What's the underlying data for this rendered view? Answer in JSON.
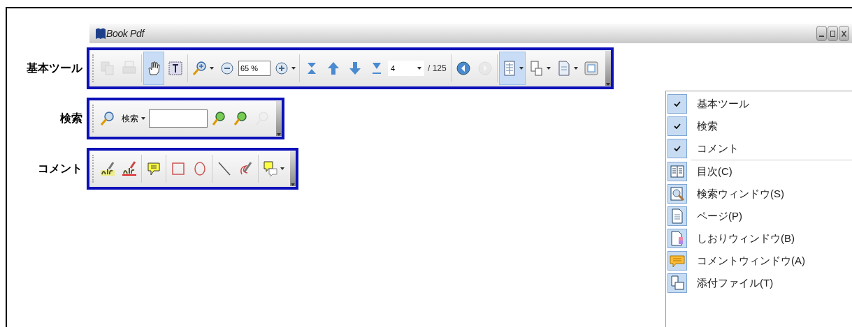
{
  "window": {
    "title": "Book Pdf"
  },
  "toolbars": [
    {
      "label": "基本ツール",
      "items": [
        {
          "kind": "button",
          "disabled": true,
          "selected": false
        },
        {
          "kind": "button",
          "disabled": true,
          "selected": false
        },
        {
          "kind": "sep"
        },
        {
          "kind": "button",
          "disabled": false,
          "selected": true
        },
        {
          "kind": "button",
          "disabled": false,
          "selected": false
        },
        {
          "kind": "sep"
        },
        {
          "kind": "menu-button",
          "disabled": false,
          "selected": false
        },
        {
          "kind": "button",
          "disabled": false,
          "selected": false
        },
        {
          "kind": "field",
          "value": "65 %"
        },
        {
          "kind": "menu-button",
          "disabled": false,
          "selected": false
        },
        {
          "kind": "sep"
        },
        {
          "kind": "button",
          "disabled": false,
          "selected": false
        },
        {
          "kind": "button",
          "disabled": false,
          "selected": false
        },
        {
          "kind": "button",
          "disabled": false,
          "selected": false
        },
        {
          "kind": "button",
          "disabled": false,
          "selected": false
        },
        {
          "kind": "combo",
          "value": "4"
        },
        {
          "kind": "text",
          "text": "/ 125"
        },
        {
          "kind": "sep"
        },
        {
          "kind": "button",
          "disabled": false,
          "selected": false
        },
        {
          "kind": "button",
          "disabled": true,
          "selected": false
        },
        {
          "kind": "sep"
        },
        {
          "kind": "menu-button",
          "disabled": false,
          "selected": true
        },
        {
          "kind": "menu-button",
          "disabled": false,
          "selected": false
        },
        {
          "kind": "menu-button",
          "disabled": false,
          "selected": false
        },
        {
          "kind": "button",
          "disabled": false,
          "selected": false
        }
      ]
    },
    {
      "label": "検索",
      "items": [
        {
          "kind": "button",
          "disabled": false,
          "selected": false
        },
        {
          "kind": "menu-text",
          "text": "検索"
        },
        {
          "kind": "input"
        },
        {
          "kind": "button",
          "disabled": false,
          "selected": false
        },
        {
          "kind": "button",
          "disabled": false,
          "selected": false
        },
        {
          "kind": "button",
          "disabled": true,
          "selected": false
        }
      ]
    },
    {
      "label": "コメント",
      "items": [
        {
          "kind": "button",
          "disabled": false,
          "selected": false
        },
        {
          "kind": "button",
          "disabled": false,
          "selected": false
        },
        {
          "kind": "sep"
        },
        {
          "kind": "button",
          "disabled": false,
          "selected": false
        },
        {
          "kind": "sep"
        },
        {
          "kind": "button",
          "disabled": false,
          "selected": false
        },
        {
          "kind": "button",
          "disabled": false,
          "selected": false
        },
        {
          "kind": "sep"
        },
        {
          "kind": "button",
          "disabled": false,
          "selected": false
        },
        {
          "kind": "button",
          "disabled": false,
          "selected": false
        },
        {
          "kind": "sep"
        },
        {
          "kind": "menu-button",
          "disabled": false,
          "selected": false
        }
      ]
    }
  ],
  "menu": [
    {
      "kind": "check",
      "label": "基本ツール",
      "checked": true
    },
    {
      "kind": "check",
      "label": "検索",
      "checked": true
    },
    {
      "kind": "check",
      "label": "コメント",
      "checked": true
    },
    {
      "kind": "icon",
      "label": "目次(C)"
    },
    {
      "kind": "icon",
      "label": "検索ウィンドウ(S)"
    },
    {
      "kind": "icon",
      "label": "ページ(P)"
    },
    {
      "kind": "icon",
      "label": "しおりウィンドウ(B)"
    },
    {
      "kind": "icon",
      "label": "コメントウィンドウ(A)"
    },
    {
      "kind": "icon",
      "label": "添付ファイル(T)"
    }
  ]
}
